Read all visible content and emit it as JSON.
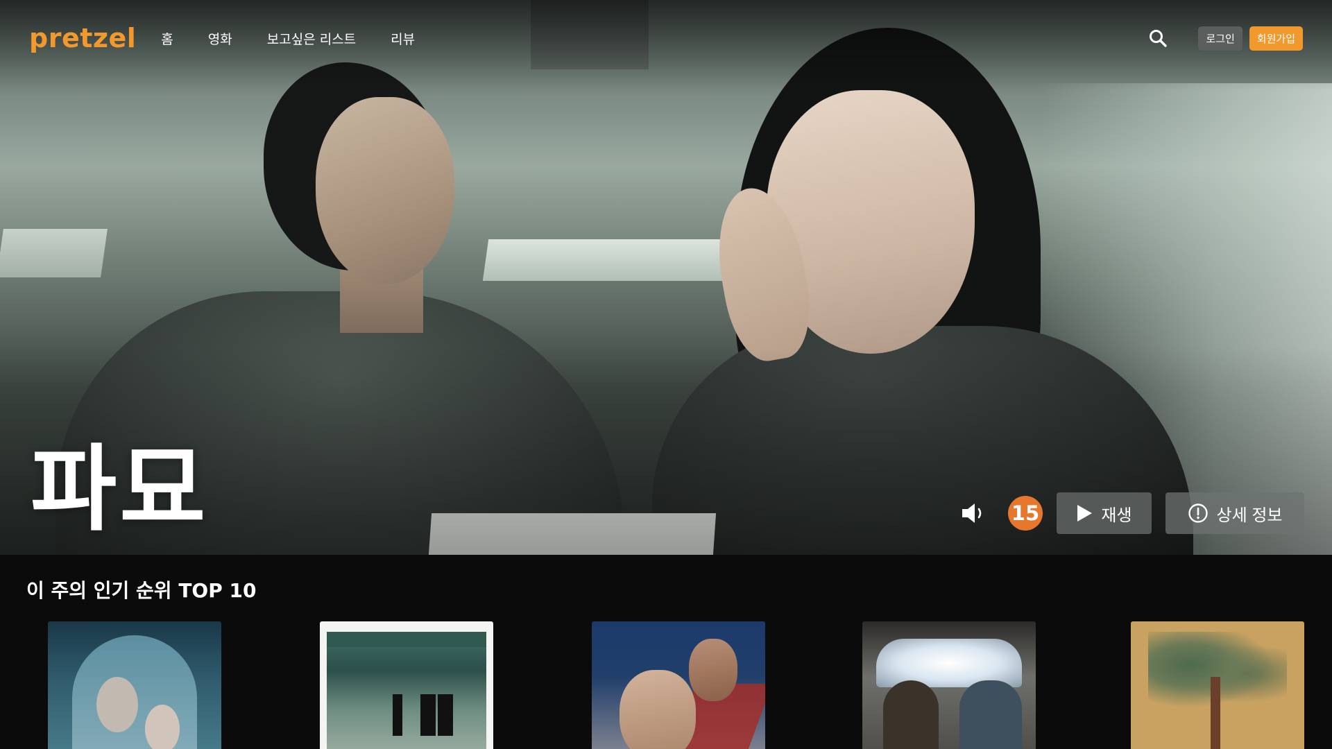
{
  "brand": {
    "logo": "pretzel",
    "accent_color": "#f2992e"
  },
  "nav": {
    "items": [
      {
        "label": "홈"
      },
      {
        "label": "영화"
      },
      {
        "label": "보고싶은 리스트"
      },
      {
        "label": "리뷰"
      }
    ],
    "search_icon": "search-icon",
    "login_label": "로그인",
    "signup_label": "회원가입"
  },
  "hero": {
    "title": "파묘",
    "age_rating": "15",
    "age_rating_color": "#e8772e",
    "mute_icon": "volume-icon",
    "play_label": "재생",
    "play_icon": "play-icon",
    "info_label": "상세 정보",
    "info_icon": "info-circle-icon"
  },
  "top10": {
    "title": "이 주의 인기 순위 TOP 10",
    "posters": [
      {
        "id": "poster-1"
      },
      {
        "id": "poster-2"
      },
      {
        "id": "poster-3"
      },
      {
        "id": "poster-4"
      },
      {
        "id": "poster-5",
        "poster_text": ""
      }
    ]
  }
}
